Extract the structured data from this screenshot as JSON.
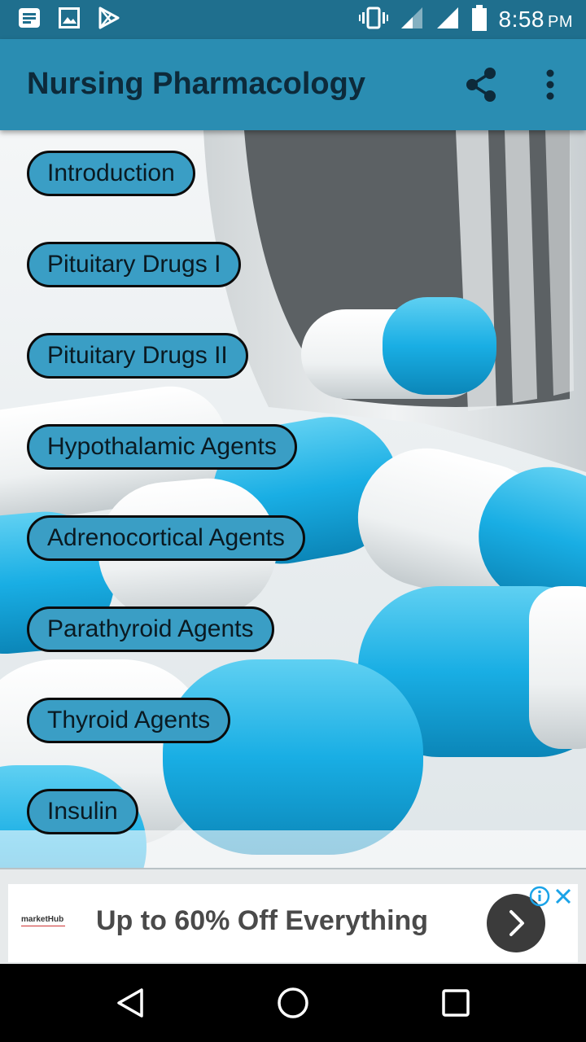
{
  "status_bar": {
    "time": "8:58",
    "ampm": "PM",
    "icons": [
      "notification-icon",
      "image-icon",
      "play-store-icon",
      "vibrate-icon",
      "signal-icon",
      "signal-icon",
      "battery-icon"
    ]
  },
  "app_bar": {
    "title": "Nursing Pharmacology",
    "actions": [
      "share-icon",
      "more-vert-icon"
    ]
  },
  "menu": {
    "items": [
      {
        "label": "Introduction"
      },
      {
        "label": "Pituitary Drugs I"
      },
      {
        "label": "Pituitary Drugs II"
      },
      {
        "label": "Hypothalamic Agents"
      },
      {
        "label": "Adrenocortical Agents"
      },
      {
        "label": "Parathyroid Agents"
      },
      {
        "label": "Thyroid Agents"
      },
      {
        "label": "Insulin"
      }
    ]
  },
  "ad": {
    "brand": "marketHub",
    "headline": "Up to 60% Off Everything",
    "icons": [
      "info-icon",
      "close-icon",
      "chevron-right-icon"
    ]
  },
  "nav_bar": {
    "buttons": [
      "back-icon",
      "home-icon",
      "recents-icon"
    ]
  },
  "colors": {
    "status_bar": "#1f6f8e",
    "app_bar": "#2a8db2",
    "button_fill": "#3a9ec5",
    "ad_info": "#1aa3e8"
  }
}
